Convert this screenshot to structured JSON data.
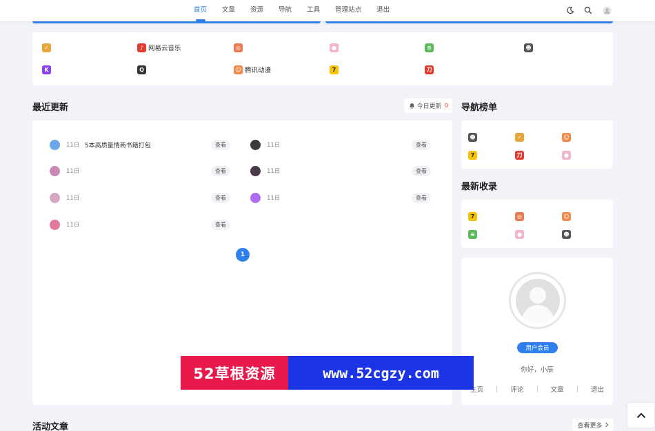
{
  "header": {
    "nav": [
      {
        "label": "首页",
        "active": true
      },
      {
        "label": "文章",
        "active": false
      },
      {
        "label": "资源",
        "active": false
      },
      {
        "label": "导航",
        "active": false
      },
      {
        "label": "工具",
        "active": false
      },
      {
        "label": "管理站点",
        "active": false
      },
      {
        "label": "退出",
        "active": false
      }
    ],
    "icons": [
      "moon-icon",
      "search-icon",
      "user-avatar-icon"
    ]
  },
  "links": [
    {
      "name": "",
      "icon": "verified-badge-icon",
      "color": "#e8a53a"
    },
    {
      "name": "网易云音乐",
      "icon": "netease-music-icon",
      "color": "#e23b30"
    },
    {
      "name": "",
      "icon": "target-icon",
      "color": "#e97a52"
    },
    {
      "name": "",
      "icon": "pig-icon",
      "color": "#f2b6c6"
    },
    {
      "name": "",
      "icon": "leaf-app-icon",
      "color": "#5cb85c"
    },
    {
      "name": "",
      "icon": "character-icon",
      "color": "#555555"
    },
    {
      "name": "",
      "icon": "k-app-icon",
      "color": "#8a3ff0"
    },
    {
      "name": "",
      "icon": "q-app-icon",
      "color": "#333333"
    },
    {
      "name": "腾讯动漫",
      "icon": "tencent-comic-icon",
      "color": "#f08a4b"
    },
    {
      "name": "",
      "icon": "seven-app-icon",
      "color": "#f5c400"
    },
    {
      "name": "",
      "icon": "xiaodao-icon",
      "color": "#e23b30"
    }
  ],
  "recent": {
    "title": "最近更新",
    "today_label": "今日更新",
    "today_count": "0",
    "view_label": "查看",
    "page": "1",
    "items": [
      {
        "date": "11日",
        "title": "5本高质量情商书籍打包",
        "avatar": "#6aa6e8"
      },
      {
        "date": "11日",
        "title": "",
        "avatar": "#3a3a3a"
      },
      {
        "date": "11日",
        "title": "",
        "avatar": "#c98ab5"
      },
      {
        "date": "11日",
        "title": "",
        "avatar": "#4a3a4a"
      },
      {
        "date": "11日",
        "title": "",
        "avatar": "#d6a7c5"
      },
      {
        "date": "11日",
        "title": "",
        "avatar": "#b06bf0"
      },
      {
        "date": "11日",
        "title": "",
        "avatar": "#e07a9a"
      }
    ]
  },
  "nav_rank": {
    "title": "导航榜单",
    "icons": [
      {
        "icon": "character-icon",
        "color": "#555555"
      },
      {
        "icon": "verified-badge-icon",
        "color": "#e8a53a"
      },
      {
        "icon": "tencent-comic-icon",
        "color": "#f08a4b"
      },
      {
        "icon": "seven-app-icon",
        "color": "#f5c400"
      },
      {
        "icon": "xiaodao-icon",
        "color": "#e23b30"
      },
      {
        "icon": "pig-icon",
        "color": "#f2b6c6"
      }
    ]
  },
  "latest": {
    "title": "最新收录",
    "icons": [
      {
        "icon": "seven-app-icon",
        "color": "#f5c400"
      },
      {
        "icon": "target-icon",
        "color": "#e97a52"
      },
      {
        "icon": "tencent-comic-icon",
        "color": "#f08a4b"
      },
      {
        "icon": "leaf-app-icon",
        "color": "#5cb85c"
      },
      {
        "icon": "pig-icon",
        "color": "#f2b6c6"
      },
      {
        "icon": "character-icon",
        "color": "#555555"
      }
    ]
  },
  "profile": {
    "badge": "用户会员",
    "greeting": "你好，小辰",
    "links": [
      "主页",
      "评论",
      "文章",
      "退出"
    ]
  },
  "banner": {
    "left": "52草根资源",
    "right": "www.52cgzy.com"
  },
  "active": {
    "title": "活动文章",
    "more": "查看更多"
  },
  "colors": {
    "accent": "#2f80ed",
    "background": "#f1f3f8",
    "banner_red": "#e8194b",
    "banner_blue": "#1b35e6"
  }
}
